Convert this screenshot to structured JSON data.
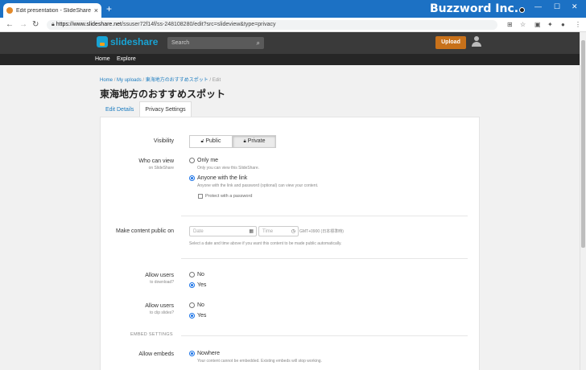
{
  "browser": {
    "tab_title": "Edit presentation - SlideShare",
    "new_tab": "+",
    "url_host": "https://www.slideshare.net",
    "url_path": "/ssuser72f14f/ss-248108280/edit?src=slideview&type=privacy",
    "watermark": "Buzzword Inc."
  },
  "header": {
    "logo_text": "slideshare",
    "search_placeholder": "Search",
    "upload_label": "Upload"
  },
  "subnav": {
    "home": "Home",
    "explore": "Explore"
  },
  "breadcrumb": {
    "home": "Home",
    "uploads": "My uploads",
    "deck": "東海地方のおすすめスポット",
    "current": "Edit",
    "sep": "/"
  },
  "page_title": "東海地方のおすすめスポット",
  "tabs": {
    "details": "Edit Details",
    "privacy": "Privacy Settings"
  },
  "visibility": {
    "label": "Visibility",
    "public": "Public",
    "private": "Private",
    "selected": "Private"
  },
  "who_can_view": {
    "label": "Who can view",
    "sub": "on SlideShare",
    "only_me": "Only me",
    "only_me_hint": "Only you can view this SlideShare.",
    "anyone": "Anyone with the link",
    "anyone_hint": "Anyone with the link and password (optional) can view your content.",
    "protect": "Protect with a password"
  },
  "make_public": {
    "label": "Make content public on",
    "date_placeholder": "Date",
    "time_placeholder": "Time",
    "timezone": "GMT+0900 (日本標準時)",
    "hint": "Select a date and time above if you want this content to be made public automatically."
  },
  "download": {
    "label": "Allow users",
    "sub": "to download?",
    "no": "No",
    "yes": "Yes"
  },
  "clip": {
    "label": "Allow users",
    "sub": "to clip slides?",
    "no": "No",
    "yes": "Yes"
  },
  "embed_section": "EMBED SETTINGS",
  "embeds": {
    "label": "Allow embeds",
    "nowhere": "Nowhere",
    "nowhere_hint": "Your content cannot be embedded. Existing embeds will stop working."
  }
}
